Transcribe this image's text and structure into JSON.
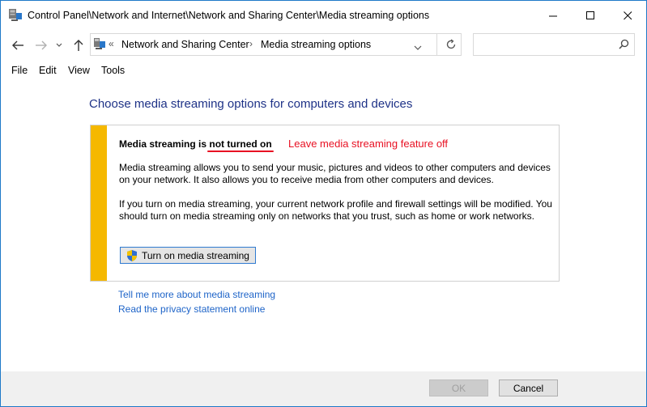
{
  "window": {
    "title": "Control Panel\\Network and Internet\\Network and Sharing Center\\Media streaming options"
  },
  "address": {
    "overflow": "«",
    "crumbs": [
      "Network and Sharing Center",
      "Media streaming options"
    ],
    "separator": "›"
  },
  "search": {
    "placeholder": ""
  },
  "menu": [
    "File",
    "Edit",
    "View",
    "Tools"
  ],
  "content": {
    "title": "Choose media streaming options for computers and devices",
    "status_prefix": "Media streaming is ",
    "status_value": "not turned on",
    "annotation": "Leave media streaming feature off",
    "paragraph1": "Media streaming allows you to send your music, pictures and videos to other computers and devices on your network.  It also allows you to receive media from other computers and devices.",
    "paragraph2": "If you turn on media streaming, your current network profile and firewall settings will be modified. You should turn on media streaming only on networks that you trust, such as home or work networks.",
    "turn_on_button": "Turn on media streaming",
    "links": [
      "Tell me more about media streaming",
      "Read the privacy statement online"
    ]
  },
  "footer": {
    "ok": "OK",
    "cancel": "Cancel"
  },
  "colors": {
    "accent_border": "#1e79c8",
    "title_blue": "#1e3287",
    "link": "#1e64c8",
    "warning_bar": "#f5b800",
    "annotation_red": "#e81123"
  }
}
